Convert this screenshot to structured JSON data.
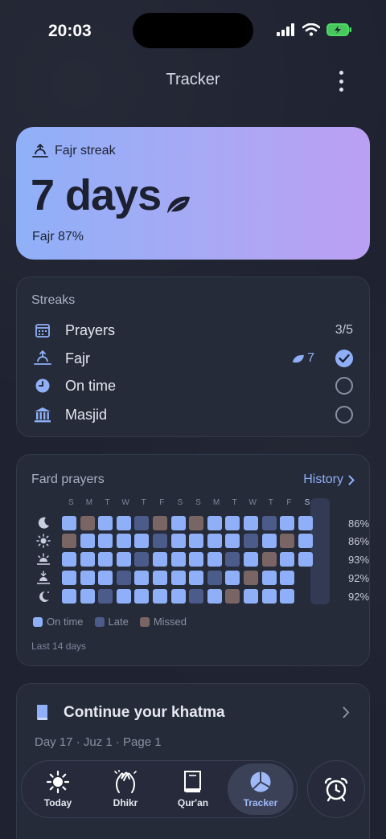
{
  "status": {
    "time": "20:03"
  },
  "nav": {
    "title": "Tracker"
  },
  "hero": {
    "label": "Fajr streak",
    "value": "7 days",
    "sub": "Fajr 87%"
  },
  "streaks": {
    "title": "Streaks",
    "items": [
      {
        "label": "Prayers",
        "count": "3/5",
        "icon": "calendar-icon"
      },
      {
        "label": "Fajr",
        "badge": "7",
        "status": "done",
        "icon": "sunrise-icon"
      },
      {
        "label": "On time",
        "status": "pending",
        "icon": "clock-icon"
      },
      {
        "label": "Masjid",
        "status": "pending",
        "icon": "mosque-icon"
      }
    ]
  },
  "fard": {
    "title": "Fard prayers",
    "history_label": "History",
    "day_labels": [
      "S",
      "M",
      "T",
      "W",
      "T",
      "F",
      "S",
      "S",
      "M",
      "T",
      "W",
      "T",
      "F",
      "S"
    ],
    "rows": [
      {
        "icon": "moon-icon",
        "pct": "86%",
        "cells": [
          "o",
          "m",
          "o",
          "o",
          "l",
          "m",
          "o",
          "m",
          "o",
          "o",
          "o",
          "l",
          "o",
          "o"
        ]
      },
      {
        "icon": "sun-icon",
        "pct": "86%",
        "cells": [
          "m",
          "o",
          "o",
          "o",
          "o",
          "l",
          "o",
          "o",
          "o",
          "o",
          "l",
          "o",
          "m",
          "o"
        ]
      },
      {
        "icon": "sunset-icon",
        "pct": "93%",
        "cells": [
          "o",
          "o",
          "o",
          "o",
          "l",
          "o",
          "o",
          "o",
          "o",
          "l",
          "o",
          "m",
          "o",
          "o"
        ]
      },
      {
        "icon": "sundown-icon",
        "pct": "92%",
        "cells": [
          "o",
          "o",
          "o",
          "l",
          "o",
          "o",
          "o",
          "o",
          "l",
          "o",
          "m",
          "o",
          "o",
          ""
        ]
      },
      {
        "icon": "night-moon-icon",
        "pct": "92%",
        "cells": [
          "o",
          "o",
          "l",
          "o",
          "o",
          "o",
          "o",
          "l",
          "o",
          "m",
          "o",
          "o",
          "o",
          ""
        ]
      }
    ],
    "legend": {
      "ontime": "On time",
      "late": "Late",
      "missed": "Missed"
    },
    "footer": "Last 14 days",
    "colors": {
      "ontime": "#8fb0f8",
      "late": "#4b5b8a",
      "missed": "#7a6565",
      "today_col": "#323a54"
    }
  },
  "khatma": {
    "title": "Continue your khatma",
    "sub": "Day 17 · Juz 1 · Page 1"
  },
  "tabs": [
    {
      "label": "Today",
      "icon": "sun-icon"
    },
    {
      "label": "Dhikr",
      "icon": "hands-icon"
    },
    {
      "label": "Qur'an",
      "icon": "book-icon"
    },
    {
      "label": "Tracker",
      "icon": "pie-chart-icon",
      "active": true
    }
  ],
  "colors": {
    "accent": "#8fb0f8",
    "hero_start": "#8fb0f8",
    "hero_end": "#bb9ff2"
  }
}
